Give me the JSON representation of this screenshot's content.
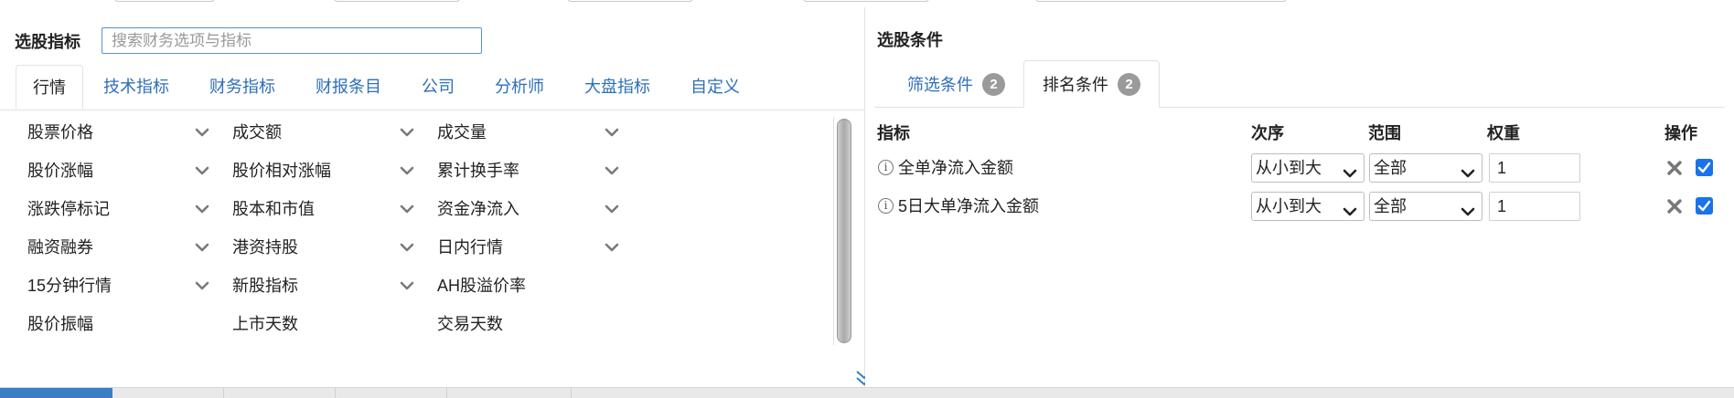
{
  "left": {
    "title": "选股指标",
    "search_placeholder": "搜索财务选项与指标",
    "tabs": [
      "行情",
      "技术指标",
      "财务指标",
      "财报条目",
      "公司",
      "分析师",
      "大盘指标",
      "自定义"
    ],
    "grid": [
      {
        "label": "股票价格",
        "expandable": true
      },
      {
        "label": "成交额",
        "expandable": true
      },
      {
        "label": "成交量",
        "expandable": true
      },
      {
        "label": "股价涨幅",
        "expandable": true
      },
      {
        "label": "股价相对涨幅",
        "expandable": true
      },
      {
        "label": "累计换手率",
        "expandable": true
      },
      {
        "label": "涨跌停标记",
        "expandable": true
      },
      {
        "label": "股本和市值",
        "expandable": true
      },
      {
        "label": "资金净流入",
        "expandable": true
      },
      {
        "label": "融资融券",
        "expandable": true
      },
      {
        "label": "港资持股",
        "expandable": true
      },
      {
        "label": "日内行情",
        "expandable": true
      },
      {
        "label": "15分钟行情",
        "expandable": true
      },
      {
        "label": "新股指标",
        "expandable": true
      },
      {
        "label": "AH股溢价率",
        "expandable": false
      },
      {
        "label": "股价振幅",
        "expandable": false
      },
      {
        "label": "上市天数",
        "expandable": false
      },
      {
        "label": "交易天数",
        "expandable": false
      }
    ]
  },
  "right": {
    "title": "选股条件",
    "tabs": [
      {
        "label": "筛选条件",
        "count": "2"
      },
      {
        "label": "排名条件",
        "count": "2"
      }
    ],
    "headers": {
      "indicator": "指标",
      "order": "次序",
      "range": "范围",
      "weight": "权重",
      "action": "操作"
    },
    "rows": [
      {
        "name": "全单净流入金额",
        "order": "从小到大",
        "range": "全部",
        "weight": "1",
        "checked": true
      },
      {
        "name": "5日大单净流入金额",
        "order": "从小到大",
        "range": "全部",
        "weight": "1",
        "checked": true
      }
    ]
  },
  "colors": {
    "link": "#2e6fb8",
    "checkbox": "#1a73e8",
    "badge": "#9a9a9a"
  }
}
